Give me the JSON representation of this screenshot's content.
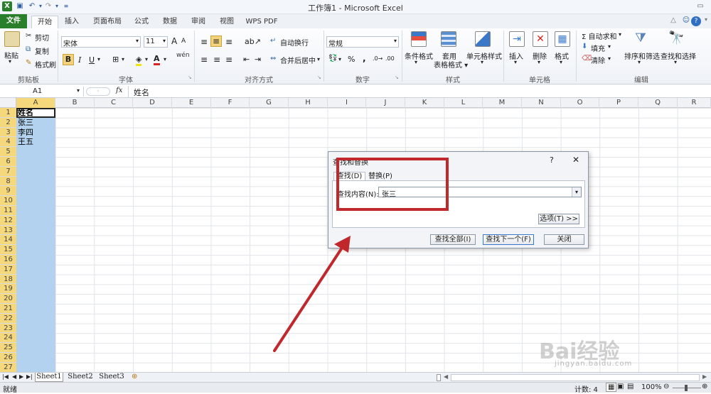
{
  "window": {
    "title": "工作簿1 - Microsoft Excel"
  },
  "tabs": [
    "文件",
    "开始",
    "插入",
    "页面布局",
    "公式",
    "数据",
    "审阅",
    "视图",
    "WPS PDF"
  ],
  "ribbon": {
    "clipboard": {
      "paste": "粘贴",
      "cut": "剪切",
      "copy": "复制",
      "format_painter": "格式刷",
      "label": "剪贴板"
    },
    "font": {
      "name": "宋体",
      "size": "11",
      "bold": "B",
      "italic": "I",
      "underline": "U",
      "label": "字体",
      "grow": "A",
      "shrink": "A",
      "phonetic": "wén"
    },
    "alignment": {
      "wrap": "自动换行",
      "merge": "合并后居中",
      "label": "对齐方式"
    },
    "number": {
      "format": "常规",
      "percent": "%",
      "comma": ",",
      "label": "数字"
    },
    "styles": {
      "conditional": "条件格式",
      "table": "套用\n表格格式",
      "cell": "单元格样式",
      "label": "样式"
    },
    "cells": {
      "insert": "插入",
      "delete": "删除",
      "format": "格式",
      "label": "单元格"
    },
    "editing": {
      "autosum": "Σ 自动求和",
      "fill": "填充",
      "clear": "清除",
      "sort": "排序和筛选",
      "find": "查找和选择",
      "label": "编辑"
    }
  },
  "formula_bar": {
    "name_box": "A1",
    "fx": "fx",
    "content": "姓名"
  },
  "columns": [
    "A",
    "B",
    "C",
    "D",
    "E",
    "F",
    "G",
    "H",
    "I",
    "J",
    "K",
    "L",
    "M",
    "N",
    "O",
    "P",
    "Q",
    "R"
  ],
  "rows": [
    "1",
    "2",
    "3",
    "4",
    "5",
    "6",
    "7",
    "8",
    "9",
    "10",
    "11",
    "12",
    "13",
    "14",
    "15",
    "16",
    "17",
    "18",
    "19",
    "20",
    "21",
    "22",
    "23",
    "24",
    "25",
    "26",
    "27"
  ],
  "cells": {
    "A1": "姓名",
    "A2": "张三",
    "A3": "李四",
    "A4": "王五"
  },
  "sheets": [
    "Sheet1",
    "Sheet2",
    "Sheet3"
  ],
  "status": {
    "ready": "就绪",
    "count": "计数: 4",
    "zoom": "100%"
  },
  "dialog": {
    "title": "查找和替换",
    "help": "?",
    "close": "✕",
    "tab_find": "查找(D)",
    "tab_replace": "替换(P)",
    "find_label": "查找内容(N):",
    "find_value": "张三",
    "options": "选项(T) >>",
    "find_all": "查找全部(I)",
    "find_next": "查找下一个(F)",
    "close_btn": "关闭"
  },
  "watermark": {
    "brand": "Bai经验",
    "url": "jingyan.baidu.com"
  },
  "colors": {
    "accent_file": "#2a7f2a",
    "selection": "#b2d2ef",
    "annotation": "#c0282c"
  }
}
